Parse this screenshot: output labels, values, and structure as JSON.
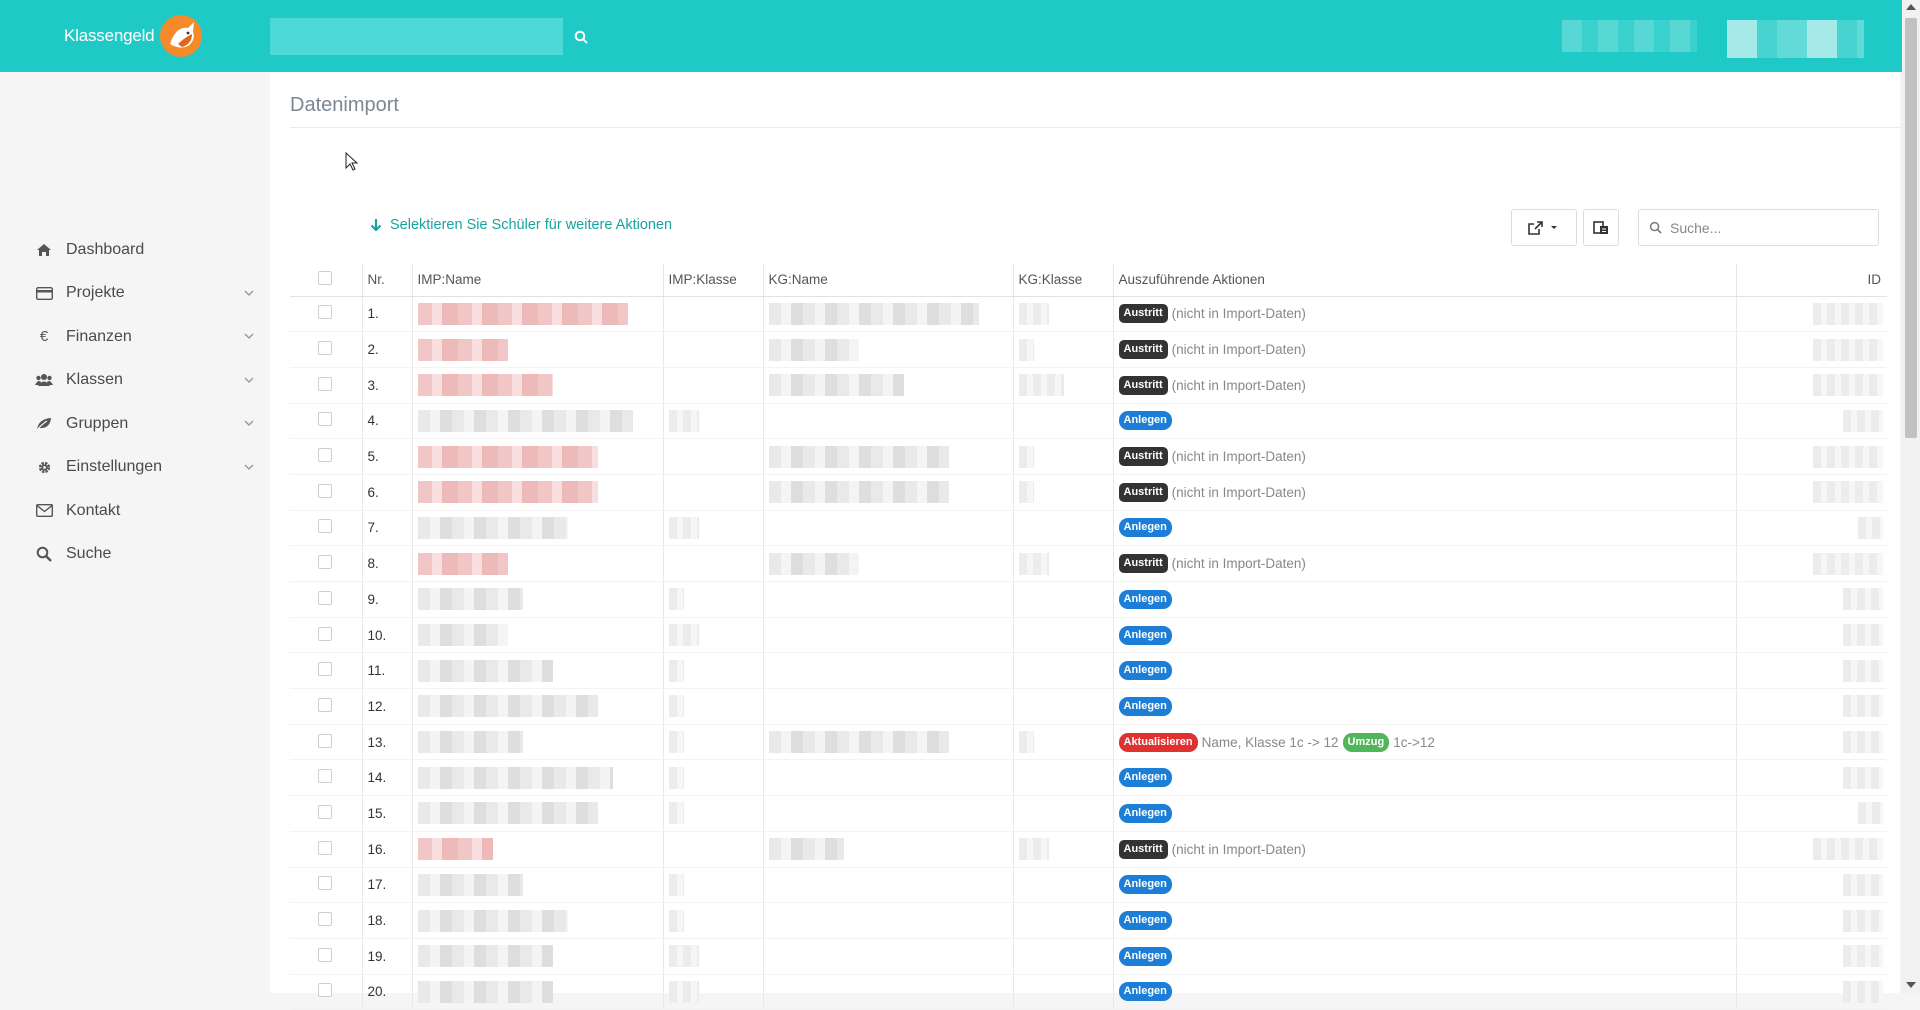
{
  "header": {
    "logo_text": "Klassengeld",
    "search_placeholder": ""
  },
  "sidebar": {
    "items": [
      {
        "label": "Dashboard",
        "icon": "home-icon",
        "expandable": false
      },
      {
        "label": "Projekte",
        "icon": "credit-card-icon",
        "expandable": true
      },
      {
        "label": "Finanzen",
        "icon": "euro-icon",
        "expandable": true
      },
      {
        "label": "Klassen",
        "icon": "users-icon",
        "expandable": true
      },
      {
        "label": "Gruppen",
        "icon": "leaf-icon",
        "expandable": true
      },
      {
        "label": "Einstellungen",
        "icon": "gear-icon",
        "expandable": true
      },
      {
        "label": "Kontakt",
        "icon": "envelope-icon",
        "expandable": false
      },
      {
        "label": "Suche",
        "icon": "search-icon",
        "expandable": false
      }
    ]
  },
  "main": {
    "title": "Datenimport",
    "select_hint": "Selektieren Sie Schüler für weitere Aktionen",
    "search_placeholder": "Suche..."
  },
  "table": {
    "columns": [
      "Nr.",
      "IMP:Name",
      "IMP:Klasse",
      "KG:Name",
      "KG:Klasse",
      "Auszuführende Aktionen",
      "ID"
    ],
    "rows": [
      {
        "nr": "1.",
        "actions": [
          {
            "badge": "Austritt",
            "type": "austritt"
          },
          {
            "note": "(nicht in Import-Daten)"
          }
        ]
      },
      {
        "nr": "2.",
        "actions": [
          {
            "badge": "Austritt",
            "type": "austritt"
          },
          {
            "note": "(nicht in Import-Daten)"
          }
        ]
      },
      {
        "nr": "3.",
        "actions": [
          {
            "badge": "Austritt",
            "type": "austritt"
          },
          {
            "note": "(nicht in Import-Daten)"
          }
        ]
      },
      {
        "nr": "4.",
        "actions": [
          {
            "badge": "Anlegen",
            "type": "anlegen"
          }
        ]
      },
      {
        "nr": "5.",
        "actions": [
          {
            "badge": "Austritt",
            "type": "austritt"
          },
          {
            "note": "(nicht in Import-Daten)"
          }
        ]
      },
      {
        "nr": "6.",
        "actions": [
          {
            "badge": "Austritt",
            "type": "austritt"
          },
          {
            "note": "(nicht in Import-Daten)"
          }
        ]
      },
      {
        "nr": "7.",
        "actions": [
          {
            "badge": "Anlegen",
            "type": "anlegen"
          }
        ]
      },
      {
        "nr": "8.",
        "actions": [
          {
            "badge": "Austritt",
            "type": "austritt"
          },
          {
            "note": "(nicht in Import-Daten)"
          }
        ]
      },
      {
        "nr": "9.",
        "actions": [
          {
            "badge": "Anlegen",
            "type": "anlegen"
          }
        ]
      },
      {
        "nr": "10.",
        "actions": [
          {
            "badge": "Anlegen",
            "type": "anlegen"
          }
        ]
      },
      {
        "nr": "11.",
        "actions": [
          {
            "badge": "Anlegen",
            "type": "anlegen"
          }
        ]
      },
      {
        "nr": "12.",
        "actions": [
          {
            "badge": "Anlegen",
            "type": "anlegen"
          }
        ]
      },
      {
        "nr": "13.",
        "actions": [
          {
            "badge": "Aktualisieren",
            "type": "aktual"
          },
          {
            "note": "Name, Klasse 1c -> 12"
          },
          {
            "badge": "Umzug",
            "type": "umzug"
          },
          {
            "note": "1c->12"
          }
        ]
      },
      {
        "nr": "14.",
        "actions": [
          {
            "badge": "Anlegen",
            "type": "anlegen"
          }
        ]
      },
      {
        "nr": "15.",
        "actions": [
          {
            "badge": "Anlegen",
            "type": "anlegen"
          }
        ]
      },
      {
        "nr": "16.",
        "actions": [
          {
            "badge": "Austritt",
            "type": "austritt"
          },
          {
            "note": "(nicht in Import-Daten)"
          }
        ]
      },
      {
        "nr": "17.",
        "actions": [
          {
            "badge": "Anlegen",
            "type": "anlegen"
          }
        ]
      },
      {
        "nr": "18.",
        "actions": [
          {
            "badge": "Anlegen",
            "type": "anlegen"
          }
        ]
      },
      {
        "nr": "19.",
        "actions": [
          {
            "badge": "Anlegen",
            "type": "anlegen"
          }
        ]
      },
      {
        "nr": "20.",
        "actions": [
          {
            "badge": "Anlegen",
            "type": "anlegen"
          }
        ]
      }
    ]
  },
  "colors": {
    "topbar": "#1fcac6",
    "accent": "#17a39f",
    "austritt": "#333333",
    "anlegen": "#1c7ed6",
    "aktualisieren": "#e03131",
    "umzug": "#51b55b"
  }
}
